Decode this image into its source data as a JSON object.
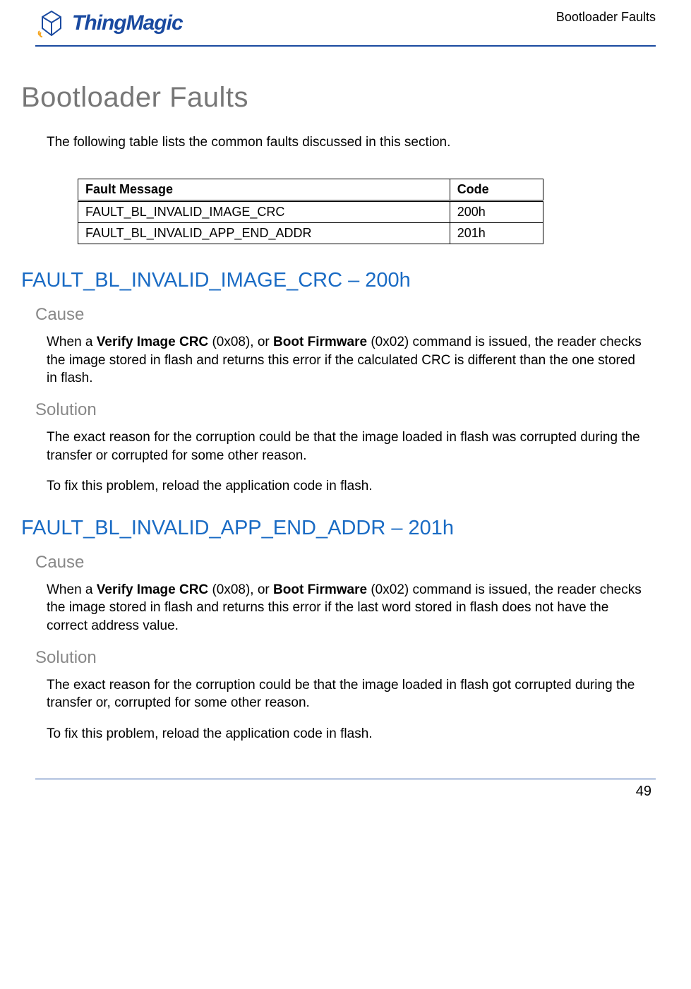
{
  "header": {
    "logo_text": "ThingMagic",
    "running_title": "Bootloader Faults"
  },
  "title": "Bootloader Faults",
  "intro": "The following table lists the common faults discussed in this section.",
  "table": {
    "headers": {
      "msg": "Fault Message",
      "code": "Code"
    },
    "rows": [
      {
        "msg": "FAULT_BL_INVALID_IMAGE_CRC",
        "code": "200h"
      },
      {
        "msg": "FAULT_BL_INVALID_APP_END_ADDR",
        "code": "201h"
      }
    ]
  },
  "sections": [
    {
      "heading": "FAULT_BL_INVALID_IMAGE_CRC – 200h",
      "cause_label": "Cause",
      "cause_pre": "When a ",
      "cause_b1": "Verify Image CRC",
      "cause_mid1": " (0x08), or ",
      "cause_b2": "Boot Firmware",
      "cause_post": " (0x02) command is issued, the reader checks the image stored in flash and returns this error if the calculated CRC is different than the one stored in flash.",
      "solution_label": "Solution",
      "solution_p1": "The exact reason for the corruption could be that the image loaded in flash was corrupted during the transfer or corrupted for some other reason.",
      "solution_p2": "To fix this problem, reload the application code in flash."
    },
    {
      "heading": "FAULT_BL_INVALID_APP_END_ADDR – 201h",
      "cause_label": "Cause",
      "cause_pre": "When a ",
      "cause_b1": "Verify Image CRC",
      "cause_mid1": " (0x08), or ",
      "cause_b2": "Boot Firmware",
      "cause_post": " (0x02) command is issued, the reader checks the image stored in flash and returns this error if the last word stored in flash does not have the correct address value.",
      "solution_label": "Solution",
      "solution_p1": "The exact reason for the corruption could be that the image loaded in flash got corrupted during the transfer or, corrupted for some other reason.",
      "solution_p2": "To fix this problem, reload the application code in flash."
    }
  ],
  "page_number": "49"
}
